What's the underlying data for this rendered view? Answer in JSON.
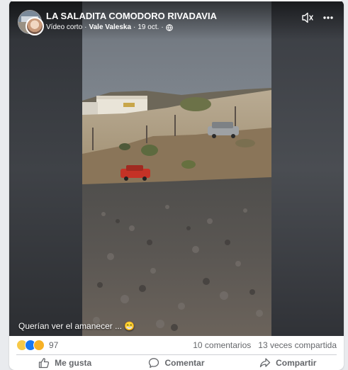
{
  "post": {
    "page_name": "LA SALADITA COMODORO RIVADAVIA",
    "type_label": "Vídeo corto",
    "author": "Vale Valeska",
    "date": "19 oct.",
    "separator": "·"
  },
  "video": {
    "caption": "Querían ver el amanecer ... 😁"
  },
  "stats": {
    "reaction_count": "97",
    "comments": "10 comentarios",
    "shares": "13 veces compartida"
  },
  "actions": {
    "like": "Me gusta",
    "comment": "Comentar",
    "share": "Compartir"
  },
  "colors": {
    "like_blue": "#1877f2",
    "love_red": "#f33e58",
    "haha_yellow": "#f7c948"
  },
  "icons": [
    "globe-icon",
    "mute-icon",
    "more-icon",
    "like-icon",
    "comment-icon",
    "share-icon"
  ]
}
